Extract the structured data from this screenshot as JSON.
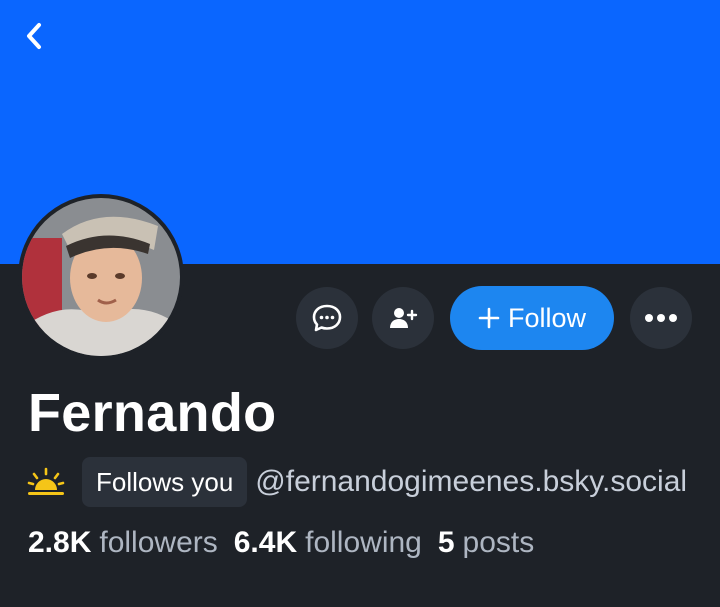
{
  "profile": {
    "display_name": "Fernando",
    "handle": "@fernandogimeenes.bsky.social",
    "follows_you_label": "Follows you"
  },
  "actions": {
    "follow_label": "Follow",
    "message_icon": "chat-bubble-icon",
    "add_user_icon": "add-user-icon",
    "more_icon": "more-icon"
  },
  "stats": {
    "followers_count": "2.8K",
    "followers_label": "followers",
    "following_count": "6.4K",
    "following_label": "following",
    "posts_count": "5",
    "posts_label": "posts"
  },
  "colors": {
    "banner": "#0a66ff",
    "background": "#1e2228",
    "follow_button": "#1d86f0",
    "icon_button": "#2b313a"
  }
}
